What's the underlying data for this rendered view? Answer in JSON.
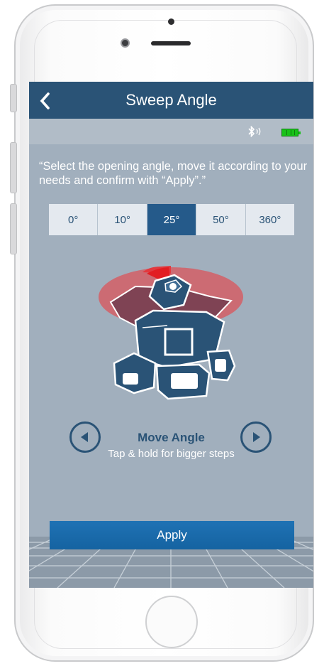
{
  "header": {
    "back_icon": "chevron-left-icon",
    "title": "Sweep Angle"
  },
  "status": {
    "bluetooth_icon": "bluetooth-icon",
    "battery_icon": "battery-icon",
    "battery_color": "#18c219"
  },
  "instruction": "“Select the opening angle, move it according to your needs and confirm with “Apply”.”",
  "angle_options": [
    "0°",
    "10°",
    "25°",
    "50°",
    "360°"
  ],
  "selected_angle": "25°",
  "move": {
    "label": "Move Angle",
    "left_icon": "arrow-left-icon",
    "right_icon": "arrow-right-icon",
    "hint": "Tap & hold for bigger steps"
  },
  "apply_label": "Apply",
  "colors": {
    "nav": "#2a5376",
    "accent": "#255a8a",
    "button": "#1f72b4",
    "laser": "#d9585e"
  }
}
